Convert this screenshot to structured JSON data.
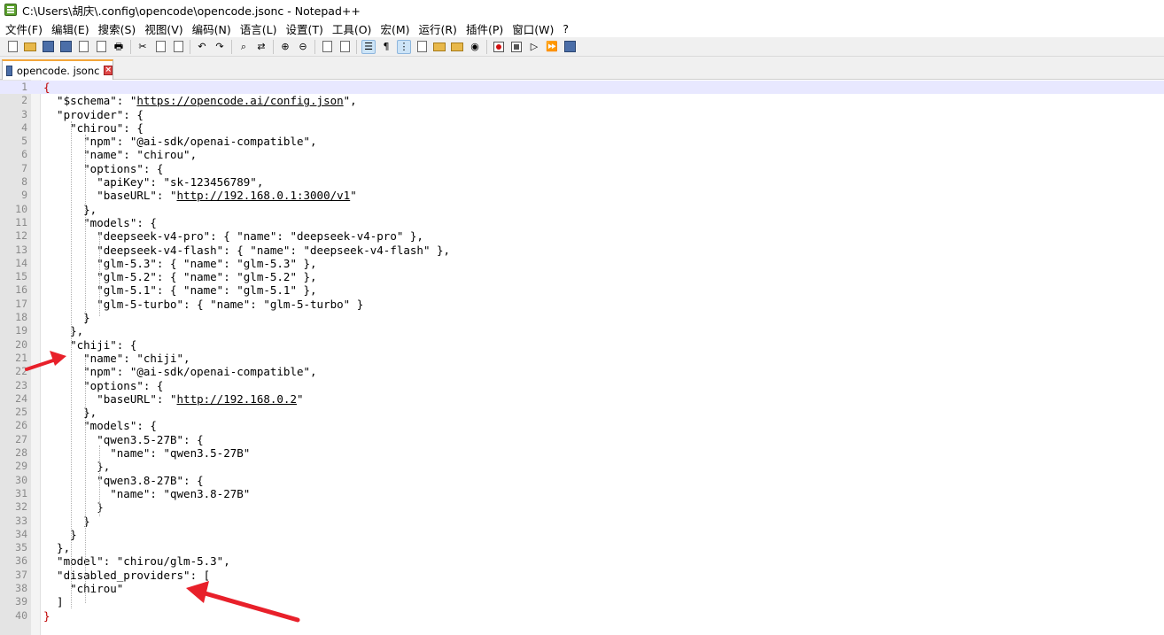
{
  "window": {
    "title": "C:\\Users\\胡庆\\.config\\opencode\\opencode.jsonc - Notepad++"
  },
  "menu": {
    "items": [
      "文件(F)",
      "编辑(E)",
      "搜索(S)",
      "视图(V)",
      "编码(N)",
      "语言(L)",
      "设置(T)",
      "工具(O)",
      "宏(M)",
      "运行(R)",
      "插件(P)",
      "窗口(W)",
      "?"
    ]
  },
  "toolbar": {
    "buttons": [
      "new-file",
      "open-file",
      "save",
      "save-all",
      "close",
      "close-all",
      "print",
      "cut",
      "copy",
      "paste",
      "undo",
      "redo",
      "find",
      "replace",
      "zoom-in",
      "zoom-out",
      "sync-vertical",
      "sync-horizontal",
      "word-wrap",
      "show-all-characters",
      "indent-guide",
      "doc-map",
      "function-list",
      "folder-as-workspace",
      "monitoring",
      "start-recording",
      "stop-recording",
      "play-macro",
      "run-macro-multiple",
      "save-macro"
    ]
  },
  "tabs": [
    {
      "label": "opencode. jsonc",
      "active": true
    }
  ],
  "editor": {
    "current_line": 1,
    "lines": [
      {
        "n": "1",
        "text": "{"
      },
      {
        "n": "2",
        "text": "  \"$schema\": \"",
        "url": "https://opencode.ai/config.json",
        "after": "\","
      },
      {
        "n": "3",
        "text": "  \"provider\": {"
      },
      {
        "n": "4",
        "text": "    \"chirou\": {"
      },
      {
        "n": "5",
        "text": "      \"npm\": \"@ai-sdk/openai-compatible\","
      },
      {
        "n": "6",
        "text": "      \"name\": \"chirou\","
      },
      {
        "n": "7",
        "text": "      \"options\": {"
      },
      {
        "n": "8",
        "text": "        \"apiKey\": \"sk-123456789\","
      },
      {
        "n": "9",
        "text": "        \"baseURL\": \"",
        "url": "http://192.168.0.1:3000/v1",
        "after": "\""
      },
      {
        "n": "10",
        "text": "      },"
      },
      {
        "n": "11",
        "text": "      \"models\": {"
      },
      {
        "n": "12",
        "text": "        \"deepseek-v4-pro\": { \"name\": \"deepseek-v4-pro\" },"
      },
      {
        "n": "13",
        "text": "        \"deepseek-v4-flash\": { \"name\": \"deepseek-v4-flash\" },"
      },
      {
        "n": "14",
        "text": "        \"glm-5.3\": { \"name\": \"glm-5.3\" },"
      },
      {
        "n": "15",
        "text": "        \"glm-5.2\": { \"name\": \"glm-5.2\" },"
      },
      {
        "n": "16",
        "text": "        \"glm-5.1\": { \"name\": \"glm-5.1\" },"
      },
      {
        "n": "17",
        "text": "        \"glm-5-turbo\": { \"name\": \"glm-5-turbo\" }"
      },
      {
        "n": "18",
        "text": "      }"
      },
      {
        "n": "19",
        "text": "    },"
      },
      {
        "n": "20",
        "text": "    \"chiji\": {"
      },
      {
        "n": "21",
        "text": "      \"name\": \"chiji\","
      },
      {
        "n": "22",
        "text": "      \"npm\": \"@ai-sdk/openai-compatible\","
      },
      {
        "n": "23",
        "text": "      \"options\": {"
      },
      {
        "n": "24",
        "text": "        \"baseURL\": \"",
        "url": "http://192.168.0.2",
        "after": "\""
      },
      {
        "n": "25",
        "text": "      },"
      },
      {
        "n": "26",
        "text": "      \"models\": {"
      },
      {
        "n": "27",
        "text": "        \"qwen3.5-27B\": {"
      },
      {
        "n": "28",
        "text": "          \"name\": \"qwen3.5-27B\""
      },
      {
        "n": "29",
        "text": "        },"
      },
      {
        "n": "30",
        "text": "        \"qwen3.8-27B\": {"
      },
      {
        "n": "31",
        "text": "          \"name\": \"qwen3.8-27B\""
      },
      {
        "n": "32",
        "text": "        }"
      },
      {
        "n": "33",
        "text": "      }"
      },
      {
        "n": "34",
        "text": "    }"
      },
      {
        "n": "35",
        "text": "  },"
      },
      {
        "n": "36",
        "text": "  \"model\": \"chirou/glm-5.3\","
      },
      {
        "n": "37",
        "text": "  \"disabled_providers\": ["
      },
      {
        "n": "38",
        "text": "    \"chirou\""
      },
      {
        "n": "39",
        "text": "  ]"
      },
      {
        "n": "40",
        "text": "}"
      }
    ]
  },
  "annotations": {
    "arrow_color": "#e8202a",
    "arrows": [
      "pointing-at-chiji-provider",
      "pointing-at-disabled-providers"
    ]
  },
  "colors": {
    "gutter": "#e4e4e4",
    "current_line": "#e8e8ff",
    "brace_match": "#c00000",
    "tab_accent": "#f3a63a"
  }
}
